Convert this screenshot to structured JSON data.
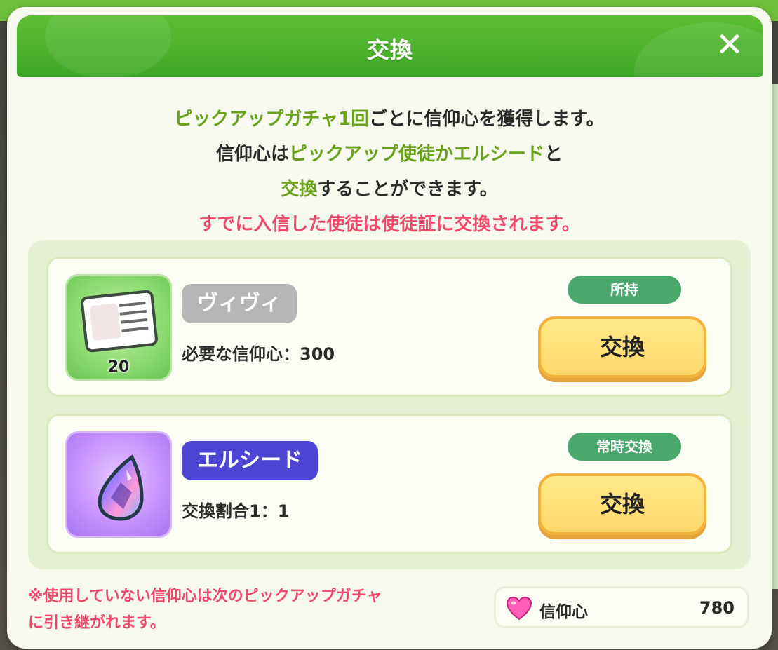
{
  "header": {
    "title": "交換"
  },
  "description": {
    "line1_highlight": "ピックアップガチャ1回",
    "line1_rest": "ごとに信仰心を獲得します。",
    "line2_prefix": "信仰心は",
    "line2_highlight": "ピックアップ使徒かエルシード",
    "line2_suffix": "と",
    "line3_highlight": "交換",
    "line3_rest": "することができます。",
    "line4_warning": "すでに入信した使徒は使徒証に交換されます。"
  },
  "items": [
    {
      "icon": "apostle-card-icon",
      "icon_count": "20",
      "name": "ヴィヴィ",
      "detail": "必要な信仰心：300",
      "tag": "所持",
      "button": "交換"
    },
    {
      "icon": "elseed-gem-icon",
      "name": "エルシード",
      "detail": "交換割合1：1",
      "tag": "常時交換",
      "button": "交換"
    }
  ],
  "footer": {
    "note_line1": "※使用していない信仰心は次のピックアップガチャ",
    "note_line2": "に引き継がれます。",
    "balance_icon": "heart-icon",
    "balance_label": "信仰心",
    "balance_value": "780"
  },
  "colors": {
    "header_green": "#4cb22c",
    "highlight_green": "#6aa21c",
    "warning_red": "#ef4a6a",
    "tag_green": "#4aa86a",
    "button_yellow": "#ffe07a",
    "badge_gray": "#b6b6b6",
    "badge_indigo": "#4e44d4"
  }
}
